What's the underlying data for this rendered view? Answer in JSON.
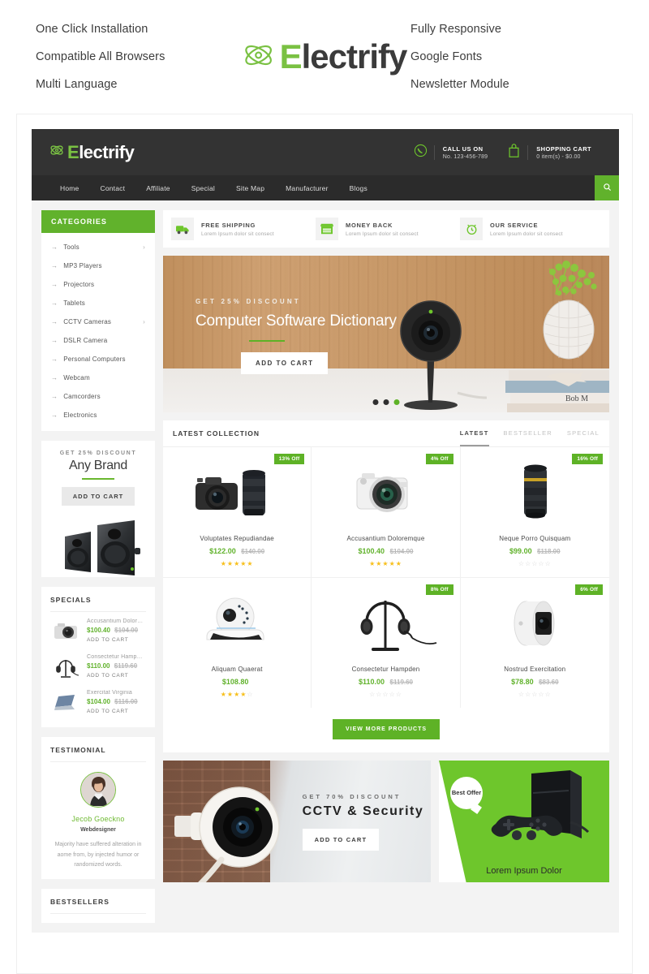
{
  "promo": {
    "left": [
      "One Click Installation",
      "Compatible All Browsers",
      "Multi Language"
    ],
    "right": [
      "Fully Responsive",
      "Google Fonts",
      "Newsletter Module"
    ],
    "logo_first": "E",
    "logo_rest": "lectrify",
    "logo_icon": "atom-icon"
  },
  "colors": {
    "brand_green": "#7ac143",
    "accent_green": "#61b22c",
    "badge_green": "#5eb226",
    "header_dark": "#333333",
    "nav_dark": "#2b2b2b",
    "star_gold": "#f7bf1b"
  },
  "header": {
    "logo_first": "E",
    "logo_rest": "lectrify",
    "call": {
      "icon": "phone-icon",
      "label": "CALL US ON",
      "value": "No. 123-456-789"
    },
    "cart": {
      "icon": "shopping-bag-icon",
      "label": "SHOPPING CART",
      "value": "0 item(s) - $0.00"
    }
  },
  "nav": {
    "items": [
      "Home",
      "Contact",
      "Affiliate",
      "Special",
      "Site Map",
      "Manufacturer",
      "Blogs"
    ],
    "search_icon": "search-icon"
  },
  "sidebar": {
    "categories_title": "CATEGORIES",
    "categories": [
      {
        "label": "Tools",
        "has_children": true
      },
      {
        "label": "MP3 Players",
        "has_children": false
      },
      {
        "label": "Projectors",
        "has_children": false
      },
      {
        "label": "Tablets",
        "has_children": false
      },
      {
        "label": "CCTV Cameras",
        "has_children": true
      },
      {
        "label": "DSLR Camera",
        "has_children": false
      },
      {
        "label": "Personal Computers",
        "has_children": false
      },
      {
        "label": "Webcam",
        "has_children": false
      },
      {
        "label": "Camcorders",
        "has_children": false
      },
      {
        "label": "Electronics",
        "has_children": false
      }
    ],
    "brand_promo": {
      "kicker": "GET 25% DISCOUNT",
      "title": "Any Brand",
      "button": "ADD TO CART",
      "image": "speakers-image"
    },
    "specials": {
      "title": "SPECIALS",
      "items": [
        {
          "name": "Accusantium Dolor…",
          "new_price": "$100.40",
          "old_price": "$104.00",
          "cta": "ADD TO CART",
          "image": "camera-thumb"
        },
        {
          "name": "Consectetur Hamp…",
          "new_price": "$110.00",
          "old_price": "$119.60",
          "cta": "ADD TO CART",
          "image": "headphones-thumb"
        },
        {
          "name": "Exercitat Virginia",
          "new_price": "$104.00",
          "old_price": "$116.00",
          "cta": "ADD TO CART",
          "image": "laptop-thumb"
        }
      ]
    },
    "testimonial": {
      "title": "TESTIMONIAL",
      "name": "Jecob Goeckno",
      "role": "Webdesigner",
      "quote": "Majority have suffered alteration in aome from, by injected humor or randomized words.",
      "avatar": "person-avatar"
    },
    "bestsellers_title": "BESTSELLERS"
  },
  "services": [
    {
      "icon": "truck-icon",
      "title": "FREE SHIPPING",
      "text": "Lorem Ipsum dolor sit consect"
    },
    {
      "icon": "store-icon",
      "title": "MONEY BACK",
      "text": "Lorem Ipsum dolor sit consect"
    },
    {
      "icon": "alarm-clock-icon",
      "title": "OUR SERVICE",
      "text": "Lorem Ipsum dolor sit consect"
    }
  ],
  "hero": {
    "kicker": "GET 25% DISCOUNT",
    "title": "Computer Software Dictionary",
    "button": "ADD TO CART",
    "dots": 3,
    "active_dot": 3,
    "image": "security-camera-desk-image"
  },
  "collection": {
    "title": "LATEST COLLECTION",
    "tabs": [
      {
        "label": "LATEST",
        "active": true
      },
      {
        "label": "BESTSELLER",
        "active": false
      },
      {
        "label": "SPECIAL",
        "active": false
      }
    ],
    "products": [
      {
        "name": "Voluptates Repudiandae",
        "new_price": "$122.00",
        "old_price": "$140.00",
        "badge": "13% Off",
        "rating": 5,
        "image": "dslr-camera-kit"
      },
      {
        "name": "Accusantium Doloremque",
        "new_price": "$100.40",
        "old_price": "$104.00",
        "badge": "4% Off",
        "rating": 5,
        "image": "white-mirrorless-camera"
      },
      {
        "name": "Neque Porro Quisquam",
        "new_price": "$99.00",
        "old_price": "$118.00",
        "badge": "16% Off",
        "rating": 0,
        "image": "telephoto-lens"
      },
      {
        "name": "Aliquam Quaerat",
        "new_price": "$108.80",
        "old_price": "",
        "badge": "",
        "rating": 4,
        "image": "ip-dome-camera"
      },
      {
        "name": "Consectetur Hampden",
        "new_price": "$110.00",
        "old_price": "$119.60",
        "badge": "8% Off",
        "rating": 0,
        "image": "headphones-stand"
      },
      {
        "name": "Nostrud Exercitation",
        "new_price": "$78.80",
        "old_price": "$83.60",
        "badge": "6% Off",
        "rating": 0,
        "image": "round-security-camera"
      }
    ],
    "view_more": "VIEW MORE PRODUCTS"
  },
  "bottom_banners": {
    "left": {
      "kicker": "GET 70% DISCOUNT",
      "title": "CCTV & Security",
      "button": "ADD TO CART",
      "image": "outdoor-cctv-camera"
    },
    "right": {
      "bubble": "Best Offer",
      "caption": "Lorem Ipsum Dolor",
      "image": "game-console-controller"
    }
  }
}
